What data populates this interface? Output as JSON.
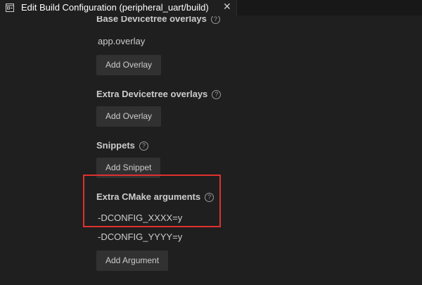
{
  "tab": {
    "icon": "settings-window-icon",
    "title": "Edit Build Configuration (peripheral_uart/build)",
    "close_glyph": "✕"
  },
  "sections": {
    "base_overlays": {
      "title": "Base Devicetree overlays",
      "value": "app.overlay",
      "button": "Add Overlay"
    },
    "extra_overlays": {
      "title": "Extra Devicetree overlays",
      "button": "Add Overlay"
    },
    "snippets": {
      "title": "Snippets",
      "button": "Add Snippet"
    },
    "cmake_args": {
      "title": "Extra CMake arguments",
      "values": [
        "-DCONFIG_XXXX=y",
        "-DCONFIG_YYYY=y"
      ],
      "button": "Add Argument"
    }
  },
  "help_glyph": "?",
  "colors": {
    "background": "#1f1f1f",
    "button": "#313131",
    "highlight": "#e0312f"
  }
}
